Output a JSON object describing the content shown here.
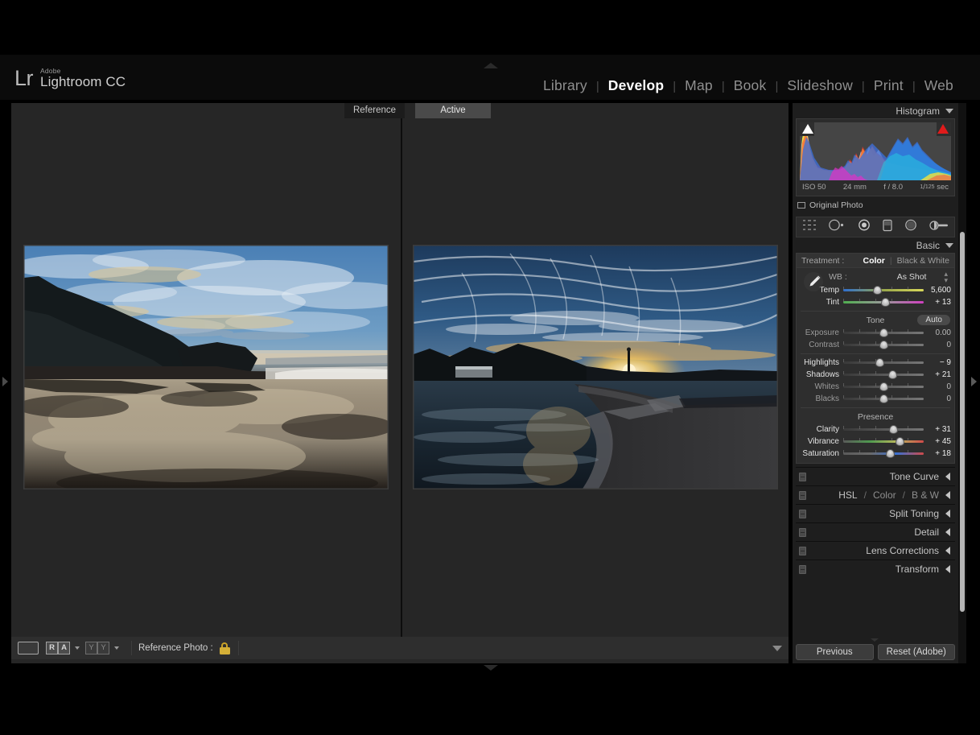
{
  "app": {
    "brand_top": "Adobe",
    "brand_name": "Lightroom CC",
    "logo_mark": "Lr"
  },
  "module_nav": {
    "separator": "|",
    "items": [
      {
        "label": "Library",
        "active": false
      },
      {
        "label": "Develop",
        "active": true
      },
      {
        "label": "Map",
        "active": false
      },
      {
        "label": "Book",
        "active": false
      },
      {
        "label": "Slideshow",
        "active": false
      },
      {
        "label": "Print",
        "active": false
      },
      {
        "label": "Web",
        "active": false
      }
    ]
  },
  "stage": {
    "tab_reference": "Reference",
    "tab_active": "Active"
  },
  "toolbar": {
    "view_icon": "loupe-view-icon",
    "compare_ra_left": "R",
    "compare_ra_right": "A",
    "compare_yy_left": "Y",
    "compare_yy_right": "Y",
    "reference_photo_label": "Reference Photo :",
    "lock_icon": "lock-closed-icon"
  },
  "histogram": {
    "title": "Histogram",
    "iso": "ISO 50",
    "focal": "24 mm",
    "aperture": "f / 8.0",
    "shutter_numerator": "1",
    "shutter_denominator": "125",
    "shutter_unit": "sec",
    "original_photo_label": "Original Photo",
    "clip_shadow_icon": "shadow-clipping-icon",
    "clip_highlight_icon": "highlight-clipping-icon"
  },
  "tools": [
    {
      "name": "crop-overlay-icon"
    },
    {
      "name": "spot-removal-icon"
    },
    {
      "name": "red-eye-correction-icon"
    },
    {
      "name": "graduated-filter-icon"
    },
    {
      "name": "radial-filter-icon"
    },
    {
      "name": "adjustment-brush-icon"
    }
  ],
  "basic": {
    "title": "Basic",
    "treatment_label": "Treatment :",
    "treatment_options": [
      "Color",
      "Black & White"
    ],
    "treatment_selected": "Color",
    "wb_label": "WB :",
    "wb_value": "As Shot",
    "tone_title": "Tone",
    "auto_label": "Auto",
    "presence_title": "Presence",
    "sliders": [
      {
        "name": "Temp",
        "value": "5,600",
        "pos": 42,
        "track": "temp",
        "modified": true
      },
      {
        "name": "Tint",
        "value": "+ 13",
        "pos": 52,
        "track": "tint",
        "modified": true
      },
      {
        "name": "Exposure",
        "value": "0.00",
        "pos": 50,
        "track": "dark",
        "modified": false
      },
      {
        "name": "Contrast",
        "value": "0",
        "pos": 50,
        "track": "dark",
        "modified": false
      },
      {
        "name": "Highlights",
        "value": "− 9",
        "pos": 45,
        "track": "dark",
        "modified": true
      },
      {
        "name": "Shadows",
        "value": "+ 21",
        "pos": 61,
        "track": "dark",
        "modified": true
      },
      {
        "name": "Whites",
        "value": "0",
        "pos": 50,
        "track": "dark",
        "modified": false
      },
      {
        "name": "Blacks",
        "value": "0",
        "pos": 50,
        "track": "dark",
        "modified": false
      },
      {
        "name": "Clarity",
        "value": "+ 31",
        "pos": 62,
        "track": "dark",
        "modified": true
      },
      {
        "name": "Vibrance",
        "value": "+ 45",
        "pos": 70,
        "track": "vib",
        "modified": true
      },
      {
        "name": "Saturation",
        "value": "+ 18",
        "pos": 58,
        "track": "sat",
        "modified": true
      }
    ]
  },
  "collapsed_panels": [
    {
      "title": "Tone Curve",
      "parts": null
    },
    {
      "title": null,
      "parts": [
        "HSL",
        "Color",
        "B & W"
      ]
    },
    {
      "title": "Split Toning",
      "parts": null
    },
    {
      "title": "Detail",
      "parts": null
    },
    {
      "title": "Lens Corrections",
      "parts": null
    },
    {
      "title": "Transform",
      "parts": null
    }
  ],
  "panel_buttons": {
    "previous": "Previous",
    "reset": "Reset (Adobe)"
  },
  "colors": {
    "background": "#000000",
    "panel": "#1e1e1e",
    "stage": "#262626",
    "accent_text": "#ffffff",
    "lock_gold": "#d4af37",
    "clip_highlight": "#e01b1b"
  },
  "photos": {
    "reference": {
      "name": "beach-sunset-reflection-photo"
    },
    "active": {
      "name": "harbour-pier-sunset-photo"
    }
  }
}
